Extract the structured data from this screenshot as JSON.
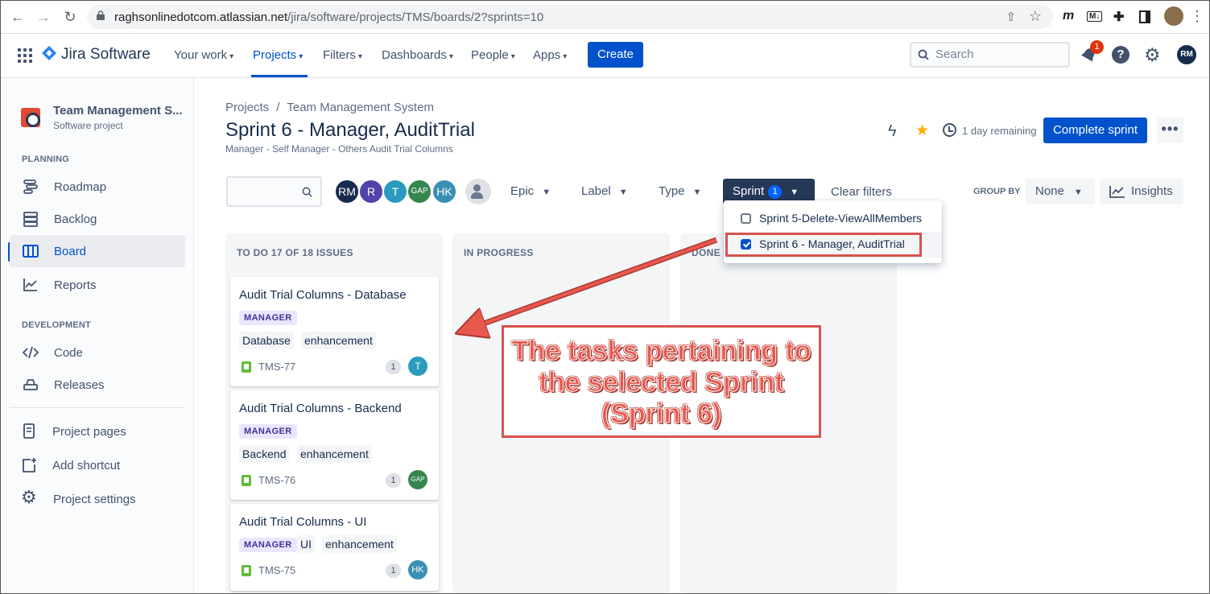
{
  "browser": {
    "url_host": "raghsonlinedotcom.atlassian.net",
    "url_path": "/jira/software/projects/TMS/boards/2?sprints=10"
  },
  "topnav": {
    "product": "Jira Software",
    "menu": [
      {
        "label": "Your work"
      },
      {
        "label": "Projects"
      },
      {
        "label": "Filters"
      },
      {
        "label": "Dashboards"
      },
      {
        "label": "People"
      },
      {
        "label": "Apps"
      }
    ],
    "create_label": "Create",
    "search_placeholder": "Search",
    "notification_count": "1",
    "user_initials": "RM"
  },
  "sidebar": {
    "project_name": "Team Management S...",
    "project_type": "Software project",
    "planning_header": "PLANNING",
    "planning_items": [
      {
        "label": "Roadmap",
        "icon": "roadmap-icon"
      },
      {
        "label": "Backlog",
        "icon": "backlog-icon"
      },
      {
        "label": "Board",
        "icon": "board-icon",
        "active": true
      },
      {
        "label": "Reports",
        "icon": "reports-icon"
      }
    ],
    "development_header": "DEVELOPMENT",
    "development_items": [
      {
        "label": "Code",
        "icon": "code-icon"
      },
      {
        "label": "Releases",
        "icon": "releases-icon"
      }
    ],
    "footer_items": [
      {
        "label": "Project pages",
        "icon": "page-icon"
      },
      {
        "label": "Add shortcut",
        "icon": "add-shortcut-icon"
      },
      {
        "label": "Project settings",
        "icon": "settings-icon"
      }
    ]
  },
  "header": {
    "breadcrumb": [
      "Projects",
      "Team Management System"
    ],
    "breadcrumb_sep": "/",
    "title": "Sprint 6 - Manager, AuditTrial",
    "subtitle": "Manager - Self Manager - Others Audit Trial Columns",
    "remaining": "1 day remaining",
    "complete_label": "Complete sprint",
    "more_label": "•••"
  },
  "filters": {
    "avatars": [
      {
        "initials": "RM",
        "color": "#172b4d"
      },
      {
        "initials": "R",
        "color": "#5243aa"
      },
      {
        "initials": "T",
        "color": "#2a9bbd"
      },
      {
        "initials": "GAP",
        "color": "#36864f"
      },
      {
        "initials": "HK",
        "color": "#3a8fb5"
      }
    ],
    "epic_label": "Epic",
    "label_label": "Label",
    "type_label": "Type",
    "sprint_label": "Sprint",
    "sprint_count": "1",
    "clear_label": "Clear filters",
    "group_by_label": "GROUP BY",
    "group_by_value": "None",
    "insights_label": "Insights"
  },
  "sprint_dropdown": [
    {
      "label": "Sprint 5-Delete-ViewAllMembers",
      "checked": false
    },
    {
      "label": "Sprint 6 - Manager, AuditTrial",
      "checked": true
    }
  ],
  "columns": [
    {
      "header": "TO DO 17 OF 18 ISSUES"
    },
    {
      "header": "IN PROGRESS"
    },
    {
      "header": "DONE"
    }
  ],
  "cards": [
    {
      "title": "Audit Trial Columns - Database",
      "epic": "MANAGER",
      "labels": [
        "Database",
        "enhancement"
      ],
      "key": "TMS-77",
      "estimate": "1",
      "assignee": "T",
      "assignee_color": "#2a9bbd"
    },
    {
      "title": "Audit Trial Columns - Backend",
      "epic": "MANAGER",
      "labels": [
        "Backend",
        "enhancement"
      ],
      "key": "TMS-76",
      "estimate": "1",
      "assignee": "GAP",
      "assignee_color": "#36864f"
    },
    {
      "title": "Audit Trial Columns - UI",
      "epic": "MANAGER",
      "labels": [
        "UI",
        "enhancement"
      ],
      "key": "TMS-75",
      "estimate": "1",
      "assignee": "HK",
      "assignee_color": "#3a8fb5"
    }
  ],
  "annotation": {
    "line1": "The tasks pertaining to",
    "line2": "the selected Sprint",
    "line3": "(Sprint 6)",
    "color": "#d9534f"
  }
}
